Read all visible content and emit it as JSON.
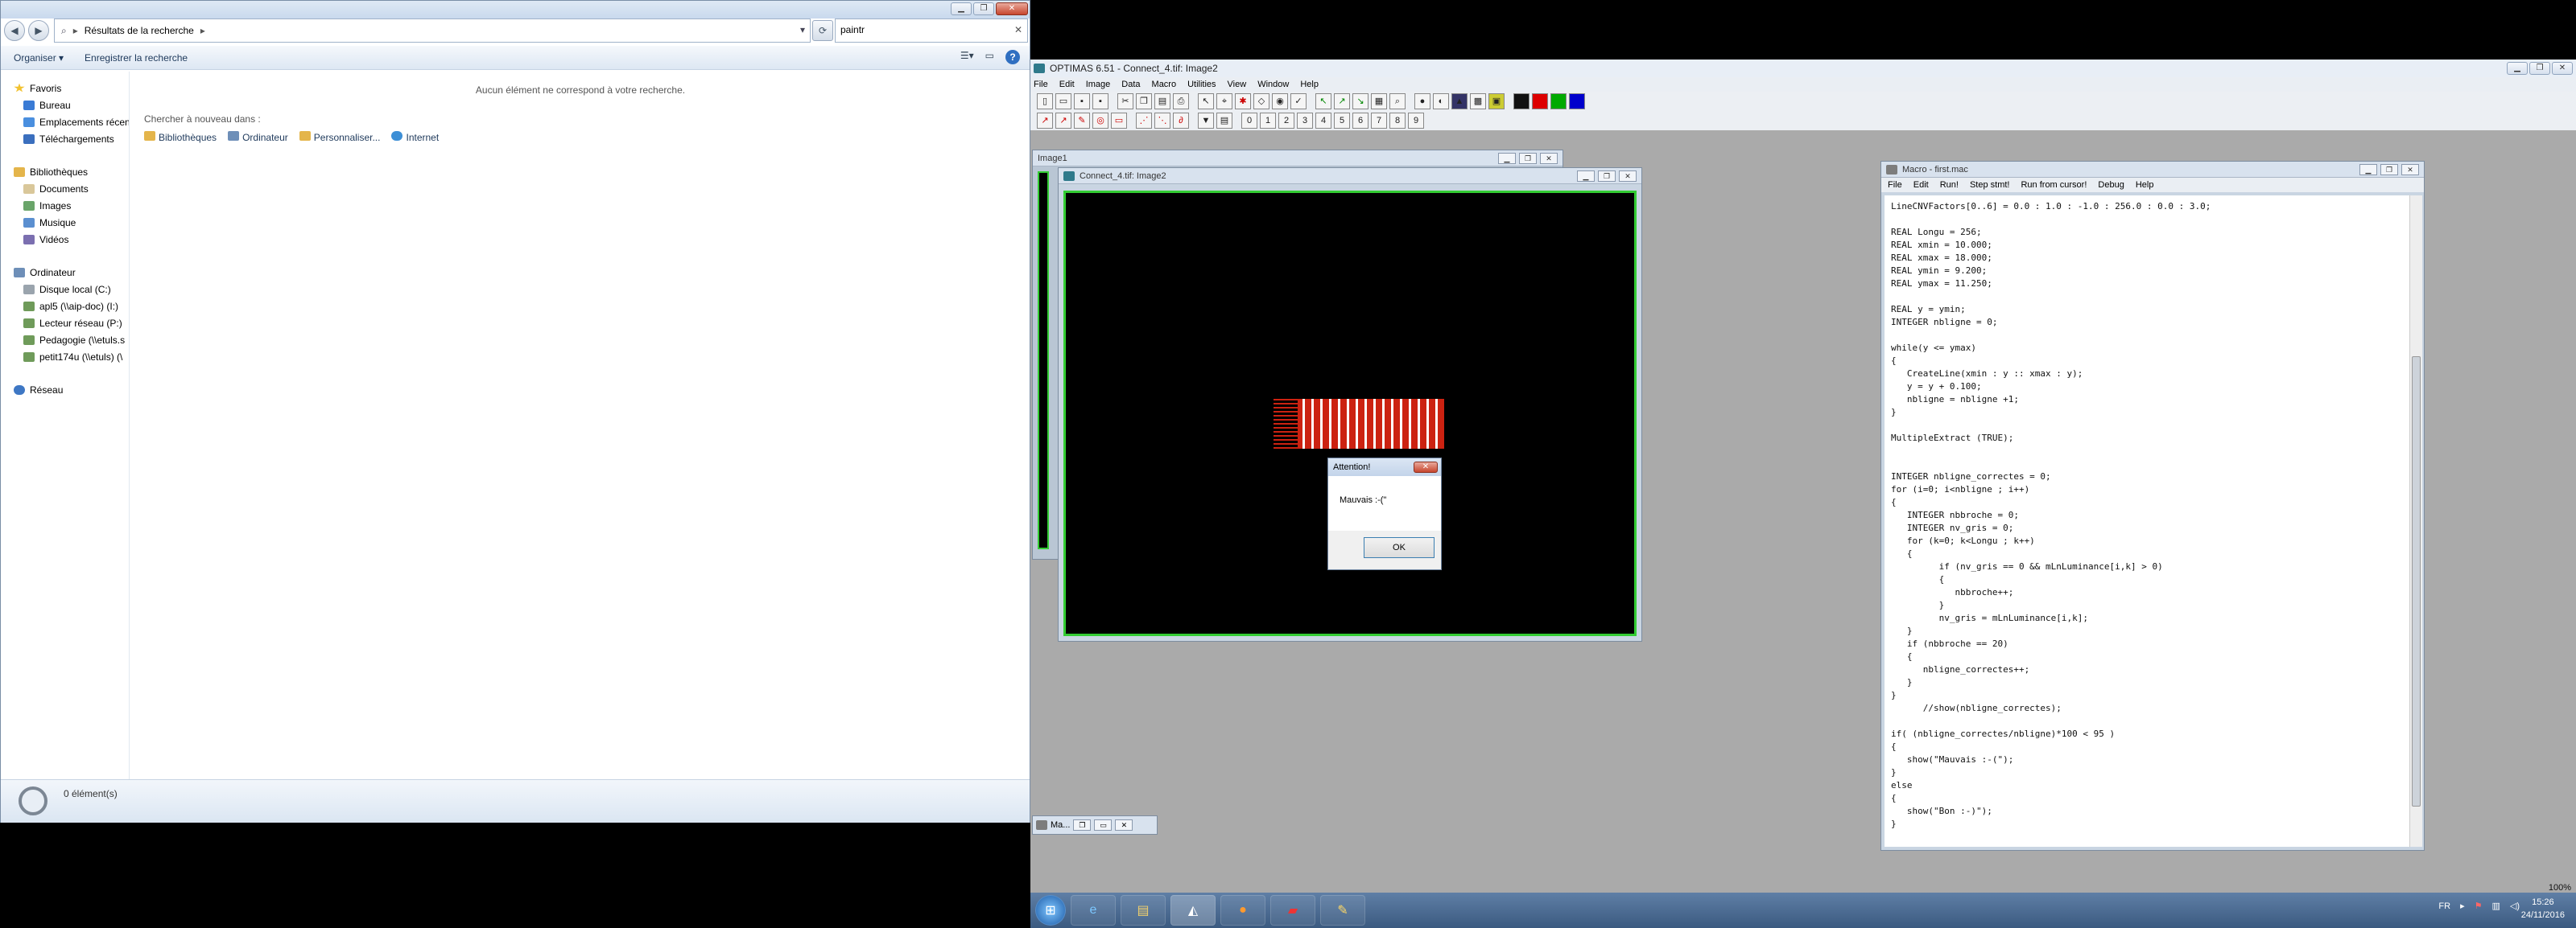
{
  "explorer": {
    "breadcrumb_sep": "▸",
    "breadcrumb": "Résultats de la recherche",
    "search_value": "paintr",
    "toolbar": {
      "organize": "Organiser ▾",
      "save_search": "Enregistrer la recherche"
    },
    "nav": {
      "favorites": "Favoris",
      "fav_items": [
        "Bureau",
        "Emplacements récents",
        "Téléchargements"
      ],
      "libraries": "Bibliothèques",
      "lib_items": [
        "Documents",
        "Images",
        "Musique",
        "Vidéos"
      ],
      "computer": "Ordinateur",
      "comp_items": [
        "Disque local (C:)",
        "apl5 (\\\\aip-doc) (I:)",
        "Lecteur réseau (P:)",
        "Pedagogie (\\\\etuls.s",
        "petit174u (\\\\etuls) (\\"
      ],
      "network": "Réseau"
    },
    "main": {
      "empty_msg": "Aucun élément ne correspond à votre recherche.",
      "search_again": "Chercher à nouveau dans :",
      "locations": [
        "Bibliothèques",
        "Ordinateur",
        "Personnaliser...",
        "Internet"
      ]
    },
    "status": "0 élément(s)"
  },
  "optimas": {
    "title": "OPTIMAS 6.51 - Connect_4.tif: Image2",
    "menu": [
      "File",
      "Edit",
      "Image",
      "Data",
      "Macro",
      "Utilities",
      "View",
      "Window",
      "Help"
    ],
    "toolbar2_digits": [
      "0",
      "1",
      "2",
      "3",
      "4",
      "5",
      "6",
      "7",
      "8",
      "9"
    ],
    "image1_title": "Image1",
    "image2_title": "Connect_4.tif: Image2",
    "dialog": {
      "title": "Attention!",
      "message": "Mauvais :-(\"",
      "ok": "OK"
    },
    "minimized_title": "Ma...",
    "macro": {
      "title": "Macro - first.mac",
      "menu": [
        "File",
        "Edit",
        "Run!",
        "Step stmt!",
        "Run from cursor!",
        "Debug",
        "Help"
      ],
      "code": "LineCNVFactors[0..6] = 0.0 : 1.0 : -1.0 : 256.0 : 0.0 : 3.0;\n\nREAL Longu = 256;\nREAL xmin = 10.000;\nREAL xmax = 18.000;\nREAL ymin = 9.200;\nREAL ymax = 11.250;\n\nREAL y = ymin;\nINTEGER nbligne = 0;\n\nwhile(y <= ymax)\n{\n   CreateLine(xmin : y :: xmax : y);\n   y = y + 0.100;\n   nbligne = nbligne +1;\n}\n\nMultipleExtract (TRUE);\n\n\nINTEGER nbligne_correctes = 0;\nfor (i=0; i<nbligne ; i++)\n{\n   INTEGER nbbroche = 0;\n   INTEGER nv_gris = 0;\n   for (k=0; k<Longu ; k++)\n   {\n         if (nv_gris == 0 && mLnLuminance[i,k] > 0)\n         {\n            nbbroche++;\n         }\n         nv_gris = mLnLuminance[i,k];\n   }\n   if (nbbroche == 20)\n   {\n      nbligne_correctes++;\n   }\n}\n      //show(nbligne_correctes);\n\nif( (nbligne_correctes/nbligne)*100 < 95 )\n{\n   show(\"Mauvais :-(\");\n}\nelse\n{\n   show(\"Bon :-)\");\n}"
    },
    "zoom": "100%"
  },
  "taskbar": {
    "lang": "FR",
    "time": "15:26",
    "date": "24/11/2016"
  }
}
